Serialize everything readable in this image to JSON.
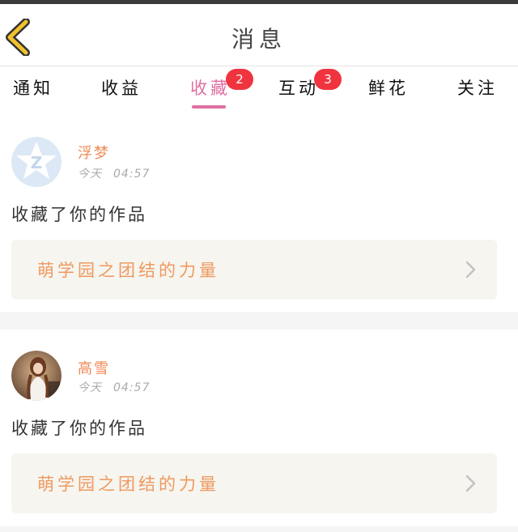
{
  "header": {
    "title": "消息"
  },
  "tabs": [
    {
      "label": "通知",
      "badge": null
    },
    {
      "label": "收益",
      "badge": null
    },
    {
      "label": "收藏",
      "badge": "2",
      "active": true
    },
    {
      "label": "互动",
      "badge": "3"
    },
    {
      "label": "鲜花",
      "badge": null
    },
    {
      "label": "关注",
      "badge": null
    }
  ],
  "notifications": [
    {
      "username": "浮梦",
      "day": "今天",
      "time": "04:57",
      "action": "收藏了你的作品",
      "work_title": "萌学园之团结的力量",
      "avatar": "default-avatar-icon"
    },
    {
      "username": "高雪",
      "day": "今天",
      "time": "04:57",
      "action": "收藏了你的作品",
      "work_title": "萌学园之团结的力量",
      "avatar": "user-photo"
    }
  ],
  "colors": {
    "accent": "#e06fa3",
    "badge": "#f0343f",
    "username": "#f08a57",
    "work_title": "#ef9960",
    "back_icon": "#f2c22c"
  }
}
